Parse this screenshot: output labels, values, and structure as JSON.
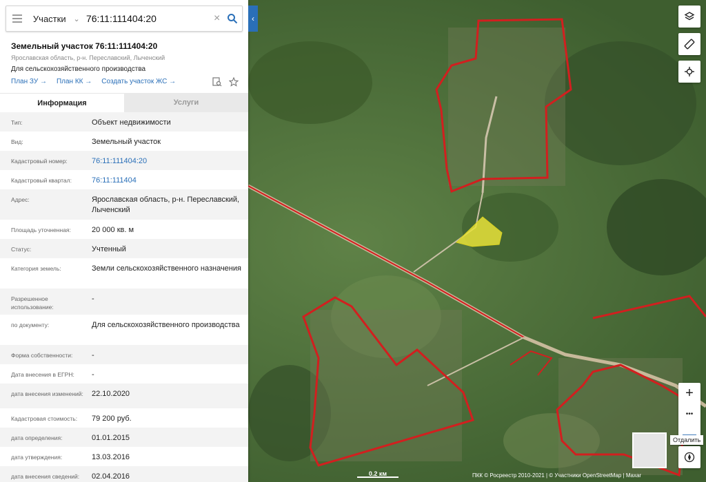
{
  "search": {
    "category": "Участки",
    "query": "76:11:111404:20"
  },
  "object": {
    "title": "Земельный участок 76:11:111404:20",
    "address": "Ярославская область, р-н. Переславский, Лыченский",
    "use": "Для сельскохозяйственного производства",
    "links": [
      "План ЗУ →",
      "План КК →",
      "Создать участок ЖС →"
    ]
  },
  "tabs": {
    "info": "Информация",
    "services": "Услуги"
  },
  "info": [
    {
      "key": "Тип:",
      "value": "Объект недвижимости"
    },
    {
      "key": "Вид:",
      "value": "Земельный участок"
    },
    {
      "key": "Кадастровый номер:",
      "value": "76:11:111404:20"
    },
    {
      "key": "Кадастровый квартал:",
      "value": "76:11:111404"
    },
    {
      "key": "Адрес:",
      "value": "Ярославская область, р-н. Переславский, Лыченский"
    },
    {
      "key": "Площадь уточненная:",
      "value": "20 000 кв. м"
    },
    {
      "key": "Статус:",
      "value": "Учтенный"
    },
    {
      "key": "Категория земель:",
      "value": "Земли сельскохозяйственного назначения"
    },
    {
      "key": "Разрешенное использование:",
      "value": "-"
    },
    {
      "key": "по документу:",
      "value": "Для сельскохозяйственного производства"
    },
    {
      "key": "Форма собственности:",
      "value": "-"
    },
    {
      "key": "Дата внесения в ЕГРН:",
      "value": "-"
    },
    {
      "key": "дата внесения изменений:",
      "value": "22.10.2020"
    },
    {
      "key": "Кадастровая стоимость:",
      "value": "79 200 руб."
    },
    {
      "key": "дата определения:",
      "value": "01.01.2015"
    },
    {
      "key": "дата утверждения:",
      "value": "13.03.2016"
    },
    {
      "key": "дата внесения сведений:",
      "value": "02.04.2016"
    }
  ],
  "map": {
    "zoom_in": "+",
    "more": "•••",
    "zoom_out": "—",
    "tooltip": "Отдалить",
    "scale": "0.2 км",
    "attribution": "ПКК © Росреестр 2010-2021 | © Участники OpenStreetMap | Maxar",
    "parcel_color": "#e8e23a",
    "boundary_color": "#d21f1f"
  }
}
